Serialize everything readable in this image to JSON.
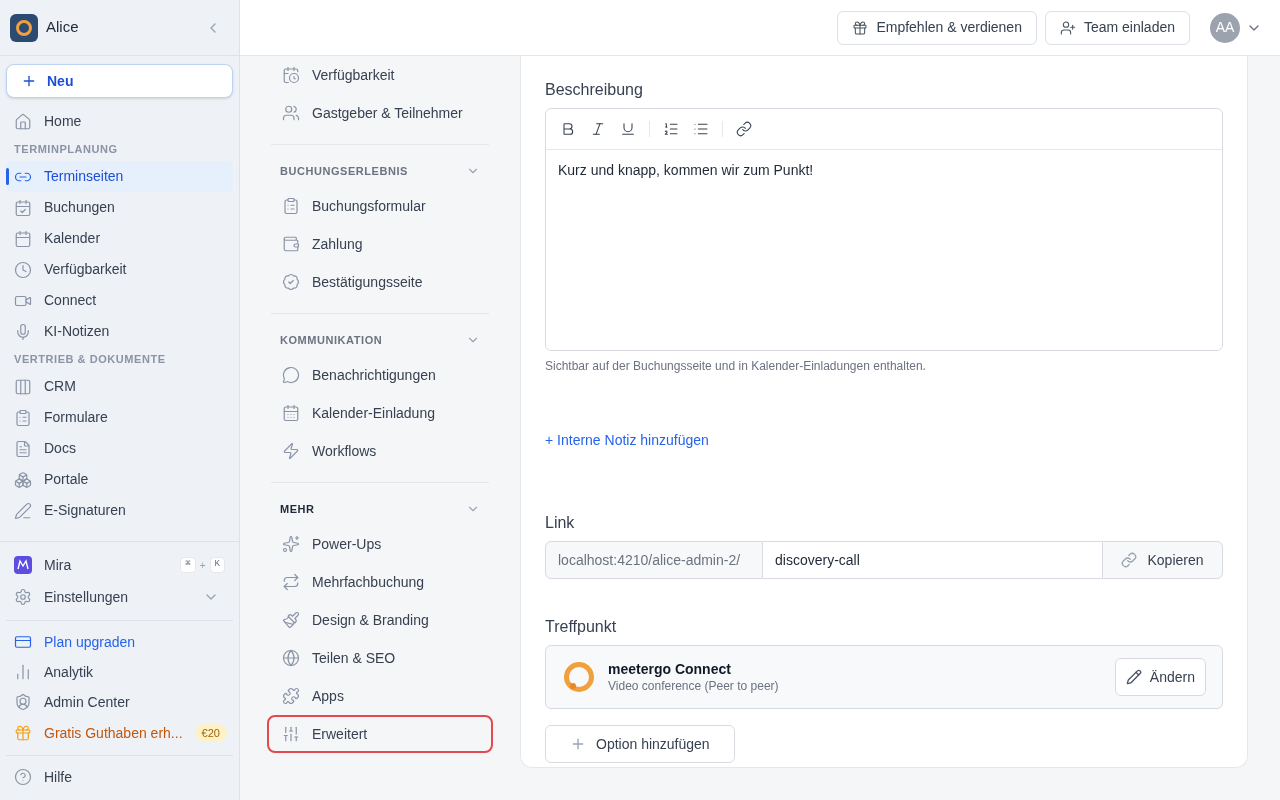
{
  "workspace": {
    "name": "Alice"
  },
  "new_button": "Neu",
  "sidebar": {
    "items": [
      {
        "kind": "item",
        "label": "Home",
        "selected": false
      },
      {
        "kind": "heading",
        "label": "TERMINPLANUNG"
      },
      {
        "kind": "item",
        "label": "Terminseiten",
        "selected": true
      },
      {
        "kind": "item",
        "label": "Buchungen",
        "selected": false
      },
      {
        "kind": "item",
        "label": "Kalender",
        "selected": false
      },
      {
        "kind": "item",
        "label": "Verfügbarkeit",
        "selected": false
      },
      {
        "kind": "item",
        "label": "Connect",
        "selected": false
      },
      {
        "kind": "item",
        "label": "KI-Notizen",
        "selected": false
      },
      {
        "kind": "heading",
        "label": "VERTRIEB & DOKUMENTE"
      },
      {
        "kind": "item",
        "label": "CRM",
        "selected": false
      },
      {
        "kind": "item",
        "label": "Formulare",
        "selected": false
      },
      {
        "kind": "item",
        "label": "Docs",
        "selected": false
      },
      {
        "kind": "item",
        "label": "Portale",
        "selected": false
      },
      {
        "kind": "item",
        "label": "E-Signaturen",
        "selected": false
      }
    ],
    "bottom": [
      {
        "kind": "assistant",
        "label": "Mira",
        "keys": [
          "⌘",
          "+",
          "K"
        ]
      },
      {
        "kind": "expandable",
        "label": "Einstellungen",
        "expanded": false
      },
      {
        "kind": "divider"
      },
      {
        "kind": "upgrade",
        "label": "Plan upgraden"
      },
      {
        "kind": "item",
        "label": "Analytik"
      },
      {
        "kind": "item",
        "label": "Admin Center"
      },
      {
        "kind": "promo",
        "label": "Gratis Guthaben erh...",
        "badge": "€20"
      },
      {
        "kind": "divider"
      },
      {
        "kind": "item",
        "label": "Hilfe"
      }
    ]
  },
  "topbar": {
    "buttons": [
      "Empfehlen & verdienen",
      "Team einladen"
    ],
    "avatar": "AA"
  },
  "settings_nav": [
    {
      "items": [
        {
          "label": "Verfügbarkeit",
          "selected": false
        },
        {
          "label": "Gastgeber & Teilnehmer",
          "selected": false
        }
      ]
    },
    {
      "heading": "BUCHUNGSERLEBNIS",
      "expanded": true,
      "items": [
        {
          "label": "Buchungsformular",
          "selected": false
        },
        {
          "label": "Zahlung",
          "selected": false
        },
        {
          "label": "Bestätigungsseite",
          "selected": false
        }
      ]
    },
    {
      "heading": "KOMMUNIKATION",
      "expanded": true,
      "items": [
        {
          "label": "Benachrichtigungen",
          "selected": false
        },
        {
          "label": "Kalender-Einladung",
          "selected": false
        },
        {
          "label": "Workflows",
          "selected": false
        }
      ]
    },
    {
      "heading": "MEHR",
      "expanded": true,
      "items": [
        {
          "label": "Power-Ups",
          "selected": false
        },
        {
          "label": "Mehrfachbuchung",
          "selected": false
        },
        {
          "label": "Design & Branding",
          "selected": false
        },
        {
          "label": "Teilen & SEO",
          "selected": false
        },
        {
          "label": "Apps",
          "selected": false
        },
        {
          "label": "Erweitert",
          "selected": true
        }
      ]
    }
  ],
  "description": {
    "label": "Beschreibung",
    "value": "Kurz und knapp, kommen wir zum Punkt!",
    "hint": "Sichtbar auf der Buchungsseite und in Kalender-Einladungen enthalten."
  },
  "internal_note_link": "+ Interne Notiz hinzufügen",
  "link": {
    "label": "Link",
    "prefix": "localhost:4210/alice-admin-2/",
    "slug": "discovery-call",
    "copy_button": "Kopieren"
  },
  "location": {
    "label": "Treffpunkt",
    "name": "meetergo Connect",
    "detail": "Video conference (Peer to peer)",
    "change_button": "Ändern",
    "add_button": "Option hinzufügen"
  }
}
